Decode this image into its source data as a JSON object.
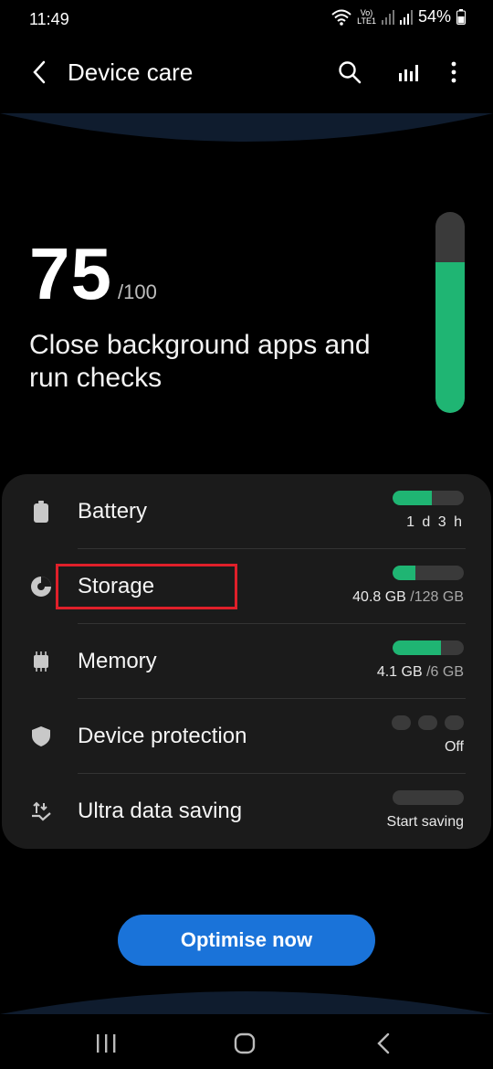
{
  "status_bar": {
    "time": "11:49",
    "network_label": "LTE1",
    "battery_percent": "54%",
    "icons": [
      "wifi-icon",
      "volte-icon",
      "signal-icon",
      "signal-icon",
      "battery-icon"
    ]
  },
  "app_bar": {
    "title": "Device care",
    "icons": [
      "back-arrow-icon",
      "search-icon",
      "bar-chart-icon",
      "more-vert-icon"
    ]
  },
  "score": {
    "value": "75",
    "max": "/100",
    "fraction": 0.75,
    "message": "Close background apps and run checks"
  },
  "items": [
    {
      "label": "Battery",
      "icon": "battery-icon",
      "value": "1 d 3 h",
      "value_muted": "",
      "level": 0.55
    },
    {
      "label": "Storage",
      "icon": "pie-chart-icon",
      "value": "40.8 GB",
      "value_muted": " /128 GB",
      "level": 0.32
    },
    {
      "label": "Memory",
      "icon": "memory-chip-icon",
      "value": "4.1 GB",
      "value_muted": " /6 GB",
      "level": 0.68
    },
    {
      "label": "Device protection",
      "icon": "shield-icon",
      "value": "Off",
      "value_muted": "",
      "level": 0
    },
    {
      "label": "Ultra data saving",
      "icon": "data-saving-icon",
      "value": "Start saving",
      "value_muted": "",
      "level": 0
    }
  ],
  "optimise_button": {
    "label": "Optimise now"
  },
  "nav": {
    "icons": [
      "recents-icon",
      "home-icon",
      "back-icon"
    ]
  },
  "colors": {
    "accent_green": "#1fb573",
    "button_blue": "#1a73d9",
    "highlight_red": "#e0202a",
    "panel_bg": "#1b1b1b"
  }
}
